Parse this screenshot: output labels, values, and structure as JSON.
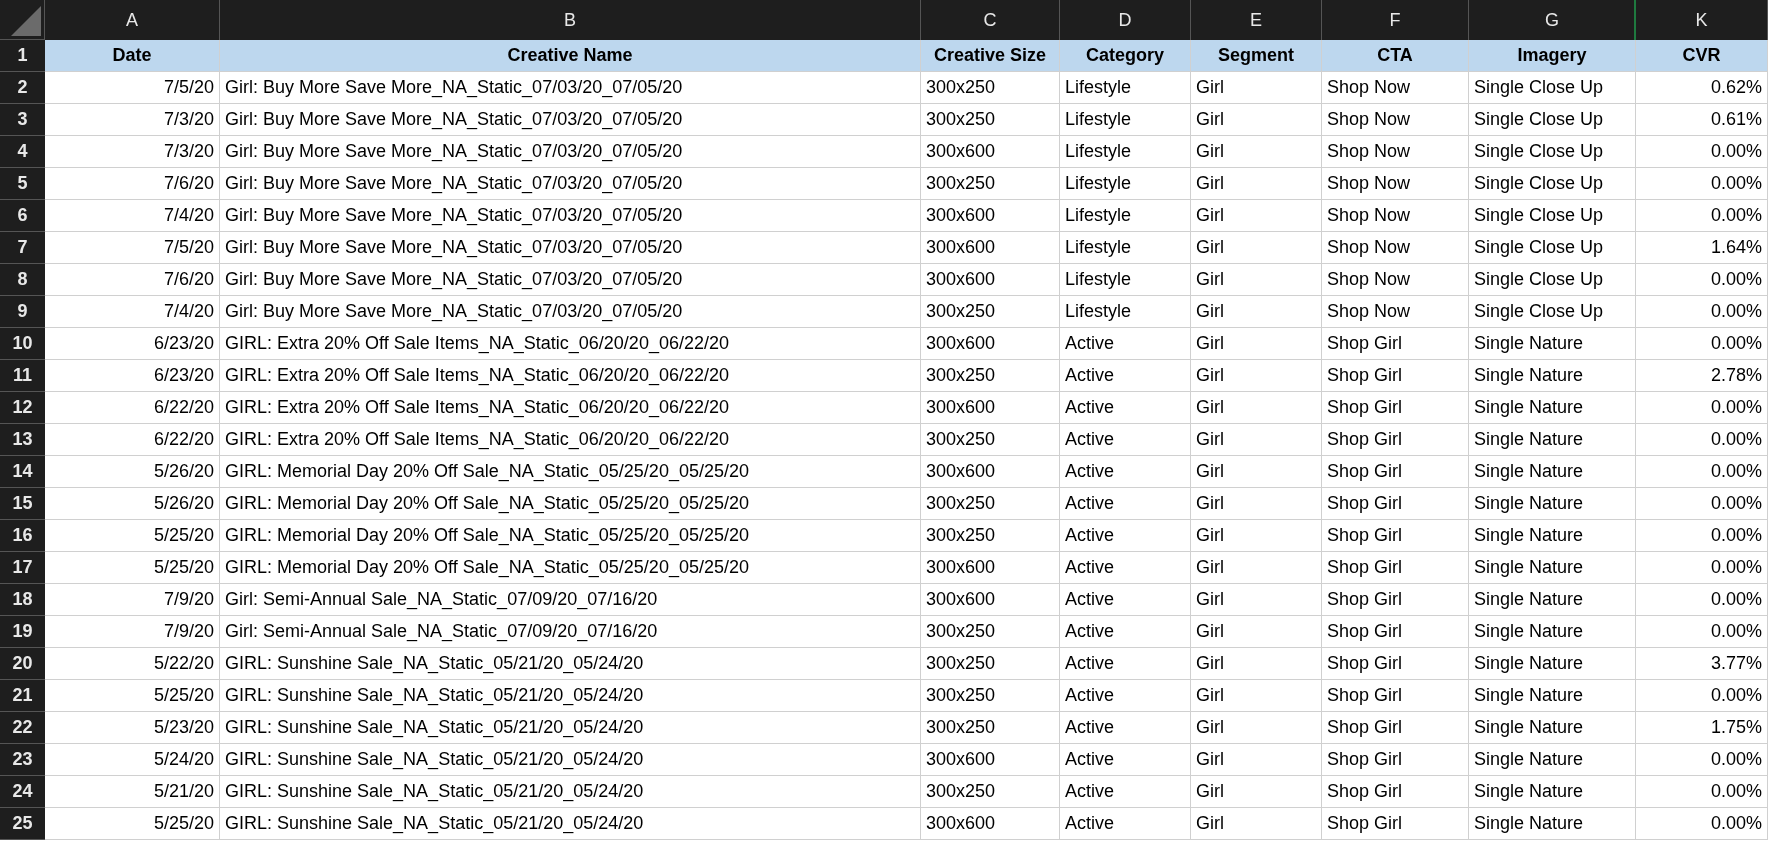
{
  "column_headers": [
    "A",
    "B",
    "C",
    "D",
    "E",
    "F",
    "G",
    "K"
  ],
  "rows": [
    {
      "number": "1",
      "kind": "header",
      "cells": [
        "Date",
        "Creative Name",
        "Creative Size",
        "Category",
        "Segment",
        "CTA",
        "Imagery",
        "CVR"
      ]
    },
    {
      "number": "2",
      "kind": "data",
      "cells": [
        "7/5/20",
        "Girl: Buy More Save More_NA_Static_07/03/20_07/05/20",
        "300x250",
        "Lifestyle",
        "Girl",
        "Shop Now",
        "Single Close Up",
        "0.62%"
      ]
    },
    {
      "number": "3",
      "kind": "data",
      "cells": [
        "7/3/20",
        "Girl: Buy More Save More_NA_Static_07/03/20_07/05/20",
        "300x250",
        "Lifestyle",
        "Girl",
        "Shop Now",
        "Single Close Up",
        "0.61%"
      ]
    },
    {
      "number": "4",
      "kind": "data",
      "cells": [
        "7/3/20",
        "Girl: Buy More Save More_NA_Static_07/03/20_07/05/20",
        "300x600",
        "Lifestyle",
        "Girl",
        "Shop Now",
        "Single Close Up",
        "0.00%"
      ]
    },
    {
      "number": "5",
      "kind": "data",
      "cells": [
        "7/6/20",
        "Girl: Buy More Save More_NA_Static_07/03/20_07/05/20",
        "300x250",
        "Lifestyle",
        "Girl",
        "Shop Now",
        "Single Close Up",
        "0.00%"
      ]
    },
    {
      "number": "6",
      "kind": "data",
      "cells": [
        "7/4/20",
        "Girl: Buy More Save More_NA_Static_07/03/20_07/05/20",
        "300x600",
        "Lifestyle",
        "Girl",
        "Shop Now",
        "Single Close Up",
        "0.00%"
      ]
    },
    {
      "number": "7",
      "kind": "data",
      "cells": [
        "7/5/20",
        "Girl: Buy More Save More_NA_Static_07/03/20_07/05/20",
        "300x600",
        "Lifestyle",
        "Girl",
        "Shop Now",
        "Single Close Up",
        "1.64%"
      ]
    },
    {
      "number": "8",
      "kind": "data",
      "cells": [
        "7/6/20",
        "Girl: Buy More Save More_NA_Static_07/03/20_07/05/20",
        "300x600",
        "Lifestyle",
        "Girl",
        "Shop Now",
        "Single Close Up",
        "0.00%"
      ]
    },
    {
      "number": "9",
      "kind": "data",
      "cells": [
        "7/4/20",
        "Girl: Buy More Save More_NA_Static_07/03/20_07/05/20",
        "300x250",
        "Lifestyle",
        "Girl",
        "Shop Now",
        "Single Close Up",
        "0.00%"
      ]
    },
    {
      "number": "10",
      "kind": "data",
      "cells": [
        "6/23/20",
        "GIRL: Extra 20% Off Sale Items_NA_Static_06/20/20_06/22/20",
        "300x600",
        "Active",
        "Girl",
        "Shop Girl",
        "Single Nature",
        "0.00%"
      ]
    },
    {
      "number": "11",
      "kind": "data",
      "cells": [
        "6/23/20",
        "GIRL: Extra 20% Off Sale Items_NA_Static_06/20/20_06/22/20",
        "300x250",
        "Active",
        "Girl",
        "Shop Girl",
        "Single Nature",
        "2.78%"
      ]
    },
    {
      "number": "12",
      "kind": "data",
      "cells": [
        "6/22/20",
        "GIRL: Extra 20% Off Sale Items_NA_Static_06/20/20_06/22/20",
        "300x600",
        "Active",
        "Girl",
        "Shop Girl",
        "Single Nature",
        "0.00%"
      ]
    },
    {
      "number": "13",
      "kind": "data",
      "cells": [
        "6/22/20",
        "GIRL: Extra 20% Off Sale Items_NA_Static_06/20/20_06/22/20",
        "300x250",
        "Active",
        "Girl",
        "Shop Girl",
        "Single Nature",
        "0.00%"
      ]
    },
    {
      "number": "14",
      "kind": "data",
      "cells": [
        "5/26/20",
        "GIRL: Memorial Day 20% Off Sale_NA_Static_05/25/20_05/25/20",
        "300x600",
        "Active",
        "Girl",
        "Shop Girl",
        "Single Nature",
        "0.00%"
      ]
    },
    {
      "number": "15",
      "kind": "data",
      "cells": [
        "5/26/20",
        "GIRL: Memorial Day 20% Off Sale_NA_Static_05/25/20_05/25/20",
        "300x250",
        "Active",
        "Girl",
        "Shop Girl",
        "Single Nature",
        "0.00%"
      ]
    },
    {
      "number": "16",
      "kind": "data",
      "cells": [
        "5/25/20",
        "GIRL: Memorial Day 20% Off Sale_NA_Static_05/25/20_05/25/20",
        "300x250",
        "Active",
        "Girl",
        "Shop Girl",
        "Single Nature",
        "0.00%"
      ]
    },
    {
      "number": "17",
      "kind": "data",
      "cells": [
        "5/25/20",
        "GIRL: Memorial Day 20% Off Sale_NA_Static_05/25/20_05/25/20",
        "300x600",
        "Active",
        "Girl",
        "Shop Girl",
        "Single Nature",
        "0.00%"
      ]
    },
    {
      "number": "18",
      "kind": "data",
      "cells": [
        "7/9/20",
        "Girl: Semi-Annual Sale_NA_Static_07/09/20_07/16/20",
        "300x600",
        "Active",
        "Girl",
        "Shop Girl",
        "Single Nature",
        "0.00%"
      ]
    },
    {
      "number": "19",
      "kind": "data",
      "cells": [
        "7/9/20",
        "Girl: Semi-Annual Sale_NA_Static_07/09/20_07/16/20",
        "300x250",
        "Active",
        "Girl",
        "Shop Girl",
        "Single Nature",
        "0.00%"
      ]
    },
    {
      "number": "20",
      "kind": "data",
      "cells": [
        "5/22/20",
        "GIRL: Sunshine Sale_NA_Static_05/21/20_05/24/20",
        "300x250",
        "Active",
        "Girl",
        "Shop Girl",
        "Single Nature",
        "3.77%"
      ]
    },
    {
      "number": "21",
      "kind": "data",
      "cells": [
        "5/25/20",
        "GIRL: Sunshine Sale_NA_Static_05/21/20_05/24/20",
        "300x250",
        "Active",
        "Girl",
        "Shop Girl",
        "Single Nature",
        "0.00%"
      ]
    },
    {
      "number": "22",
      "kind": "data",
      "cells": [
        "5/23/20",
        "GIRL: Sunshine Sale_NA_Static_05/21/20_05/24/20",
        "300x250",
        "Active",
        "Girl",
        "Shop Girl",
        "Single Nature",
        "1.75%"
      ]
    },
    {
      "number": "23",
      "kind": "data",
      "cells": [
        "5/24/20",
        "GIRL: Sunshine Sale_NA_Static_05/21/20_05/24/20",
        "300x600",
        "Active",
        "Girl",
        "Shop Girl",
        "Single Nature",
        "0.00%"
      ]
    },
    {
      "number": "24",
      "kind": "data",
      "cells": [
        "5/21/20",
        "GIRL: Sunshine Sale_NA_Static_05/21/20_05/24/20",
        "300x250",
        "Active",
        "Girl",
        "Shop Girl",
        "Single Nature",
        "0.00%"
      ]
    },
    {
      "number": "25",
      "kind": "data",
      "cells": [
        "5/25/20",
        "GIRL: Sunshine Sale_NA_Static_05/21/20_05/24/20",
        "300x600",
        "Active",
        "Girl",
        "Shop Girl",
        "Single Nature",
        "0.00%"
      ]
    }
  ]
}
